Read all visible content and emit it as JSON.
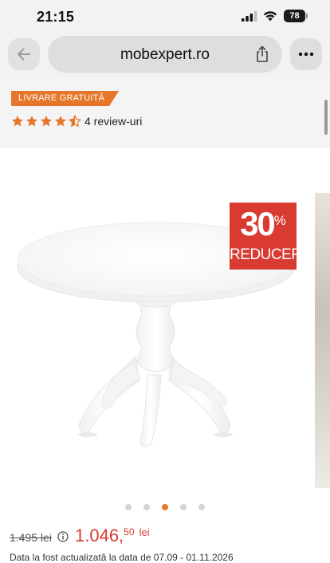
{
  "status_bar": {
    "time": "21:15",
    "battery_level": "78"
  },
  "browser": {
    "url": "mobexpert.ro"
  },
  "product": {
    "badge": "LIVRARE GRATUITĂ",
    "rating": 4.5,
    "rating_max": 5,
    "reviews_label": "4 review-uri",
    "discount_percent": "30",
    "discount_percent_sign": "%",
    "discount_label": "REDUCERE",
    "gallery_total": 5,
    "gallery_active_index": 2,
    "old_price": "1.495 lei",
    "price_integer": "1.046,",
    "price_decimals": "50",
    "price_currency": "lei",
    "cutoff_text": "Data la fost actualizată la data de 07.09 - 01.11.2026"
  },
  "colors": {
    "accent": "#e5762a",
    "discount": "#d93a31"
  }
}
